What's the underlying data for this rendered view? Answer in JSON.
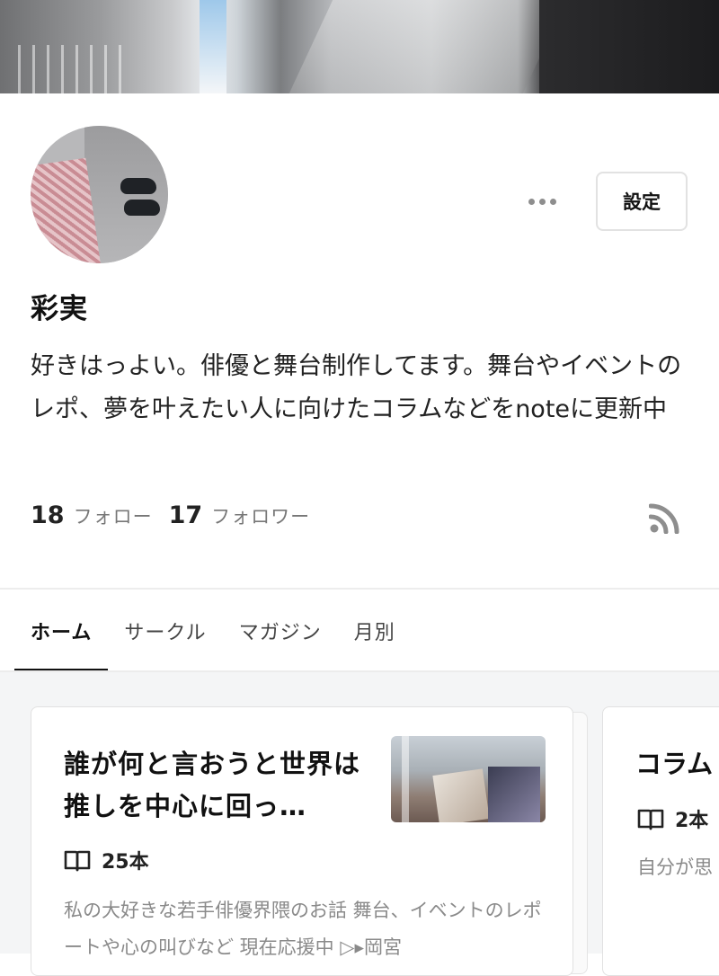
{
  "profile": {
    "name": "彩実",
    "bio": "好きはっよい。俳優と舞台制作してます。舞台やイベントのレポ、夢を叶えたい人に向けたコラムなどをnoteに更新中",
    "following_count": "18",
    "following_label": "フォロー",
    "followers_count": "17",
    "followers_label": "フォロワー"
  },
  "actions": {
    "more_icon": "ellipsis-icon",
    "settings_label": "設定",
    "rss_icon": "rss-icon"
  },
  "tabs": [
    {
      "label": "ホーム",
      "active": true
    },
    {
      "label": "サークル",
      "active": false
    },
    {
      "label": "マガジン",
      "active": false
    },
    {
      "label": "月別",
      "active": false
    }
  ],
  "magazines": [
    {
      "title": "誰が何と言おうと世界は推しを中心に回っ…",
      "count": "25本",
      "description": "私の大好きな若手俳優界隈のお話 舞台、イベントのレポートや心の叫びなど 現在応援中 ▷▸岡宮"
    },
    {
      "title": "コラム",
      "count": "2本",
      "description": "自分が思"
    }
  ],
  "colors": {
    "text": "#222222",
    "muted": "#8a8a8a",
    "border": "#e1e1e1",
    "feed_background": "#f4f5f6"
  }
}
